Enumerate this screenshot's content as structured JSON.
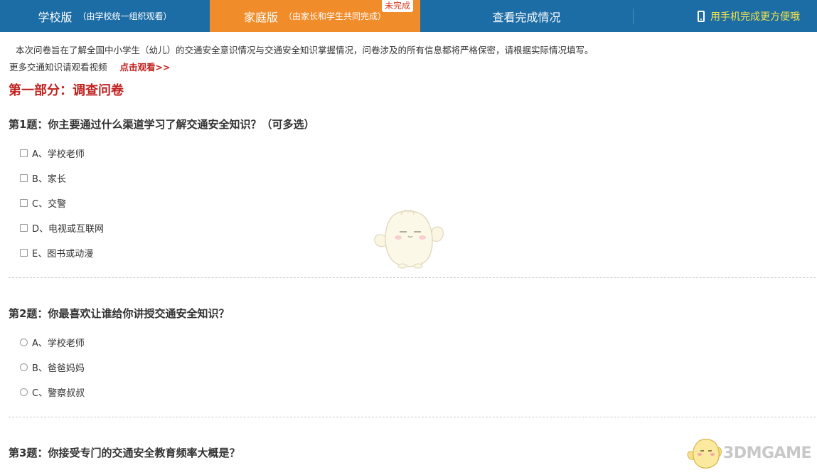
{
  "nav": {
    "tabs": [
      {
        "label": "学校版",
        "sub": "（由学校统一组织观看）"
      },
      {
        "label": "家庭版",
        "sub": "（由家长和学生共同完成）",
        "badge": "未完成",
        "active": true
      },
      {
        "label": "查看完成情况"
      }
    ],
    "mobile": "用手机完成更方便哦",
    "mobile_icon": "phone-icon"
  },
  "intro": "本次问卷旨在了解全国中小学生（幼儿）的交通安全意识情况与交通安全知识掌握情况，问卷涉及的所有信息都将严格保密，请根据实际情况填写。",
  "more": {
    "text": "更多交通知识请观看视频",
    "link": "点击观看>>"
  },
  "section_title": "第一部分：调查问卷",
  "questions": [
    {
      "title": "第1题：你主要通过什么渠道学习了解交通安全知识？（可多选）",
      "type": "checkbox",
      "options": [
        "A、学校老师",
        "B、家长",
        "C、交警",
        "D、电视或互联网",
        "E、图书或动漫"
      ]
    },
    {
      "title": "第2题：你最喜欢让谁给你讲授交通安全知识？",
      "type": "radio",
      "options": [
        "A、学校老师",
        "B、爸爸妈妈",
        "C、警察叔叔"
      ]
    },
    {
      "title": "第3题：你接受专门的交通安全教育频率大概是？",
      "type": "radio",
      "options": []
    }
  ],
  "watermark": "3DMGAME",
  "colors": {
    "nav_bg": "#1c6da6",
    "active_tab": "#f08c2a",
    "accent_red": "#c0221f",
    "mobile_text": "#f3e34a"
  }
}
